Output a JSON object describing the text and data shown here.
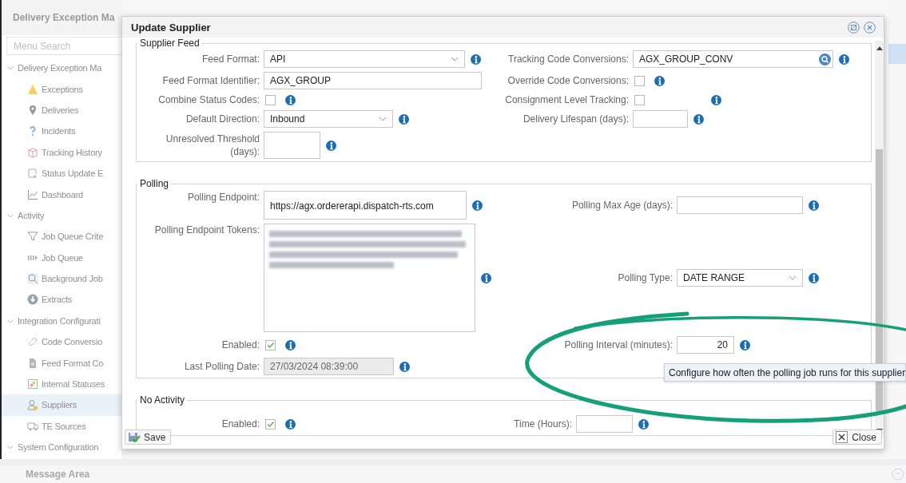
{
  "app": {
    "title": "Delivery Exception Ma",
    "menu_search": {
      "placeholder": "Menu Search"
    },
    "menu": [
      {
        "label": "Delivery Exception Ma",
        "expanded": true,
        "children": [
          {
            "label": "Exceptions",
            "selected": false
          },
          {
            "label": "Deliveries",
            "selected": false
          },
          {
            "label": "Incidents",
            "selected": false
          },
          {
            "label": "Tracking History",
            "selected": false
          },
          {
            "label": "Status Update E",
            "selected": false
          },
          {
            "label": "Dashboard",
            "selected": false
          }
        ]
      },
      {
        "label": "Activity",
        "expanded": true,
        "children": [
          {
            "label": "Job Queue Crite",
            "selected": false
          },
          {
            "label": "Job Queue",
            "selected": false
          },
          {
            "label": "Background Job",
            "selected": false
          },
          {
            "label": "Extracts",
            "selected": false
          }
        ]
      },
      {
        "label": "Integration Configurati",
        "expanded": true,
        "children": [
          {
            "label": "Code Conversio",
            "selected": false
          },
          {
            "label": "Feed Format Co",
            "selected": false
          },
          {
            "label": "Internal Statuses",
            "selected": false
          },
          {
            "label": "Suppliers",
            "selected": true
          },
          {
            "label": "TE Sources",
            "selected": false
          }
        ]
      },
      {
        "label": "System Configuration",
        "expanded": true
      }
    ],
    "message_area": {
      "title": "Message Area"
    }
  },
  "dialog": {
    "title": "Update Supplier",
    "sections": [
      {
        "legend": "Supplier Feed",
        "rows": [
          {
            "left": {
              "label": "Feed Format:",
              "kind": "select",
              "value": "API",
              "info": true
            },
            "right": {
              "label": "Tracking Code Conversions:",
              "kind": "lookup",
              "value": "AGX_GROUP_CONV",
              "info": true
            }
          },
          {
            "left": {
              "label": "Feed Format Identifier:",
              "kind": "text",
              "value": "AGX_GROUP",
              "info": false
            },
            "right": {
              "label": "Override Code Conversions:",
              "kind": "checkbox",
              "checked": false,
              "info": true
            }
          },
          {
            "left": {
              "label": "Combine Status Codes:",
              "kind": "checkbox",
              "checked": false,
              "info": true
            },
            "right": {
              "label": "Consignment Level Tracking:",
              "kind": "checkbox",
              "checked": false,
              "info": true
            }
          },
          {
            "left": {
              "label": "Default Direction:",
              "kind": "select",
              "value": "Inbound",
              "info": true
            },
            "right": {
              "label": "Delivery Lifespan (days):",
              "kind": "text",
              "info": true
            }
          },
          {
            "left": {
              "label": "Unresolved Threshold (days):",
              "kind": "text",
              "info": true
            }
          }
        ]
      },
      {
        "legend": "Polling",
        "rows": [
          {
            "left": {
              "label": "Polling Endpoint:",
              "kind": "tall-text",
              "value": "https://agx.ordererapi.dispatch-rts.com",
              "info": true
            },
            "right": {
              "label": "Polling Max Age (days):",
              "kind": "text",
              "info": true
            }
          },
          {
            "left": {
              "label": "Polling Endpoint Tokens:",
              "kind": "blurred",
              "info": true
            },
            "right": {
              "label": "Polling Type:",
              "kind": "select",
              "value": "DATE RANGE",
              "info": true
            }
          },
          {
            "left": {
              "label": "Enabled:",
              "kind": "checkbox",
              "checked": true,
              "info": true
            },
            "right": {
              "label": "Polling Interval (minutes):",
              "kind": "number",
              "value": "20",
              "info": true
            }
          },
          {
            "left": {
              "label": "Last Polling Date:",
              "kind": "readonly",
              "value": "27/03/2024 08:39:00",
              "info": true
            }
          }
        ]
      },
      {
        "legend": "No Activity",
        "rows": [
          {
            "left": {
              "label": "Enabled:",
              "kind": "checkbox",
              "checked": true,
              "info": true
            },
            "right": {
              "label": "Time (Hours):",
              "kind": "text",
              "info": true
            }
          }
        ]
      }
    ],
    "buttons": [
      {
        "label": "Save",
        "kind": "save"
      },
      {
        "label": "Close",
        "kind": "close"
      }
    ]
  },
  "tooltip": {
    "text": "Configure how often the polling job runs for this supplier"
  }
}
